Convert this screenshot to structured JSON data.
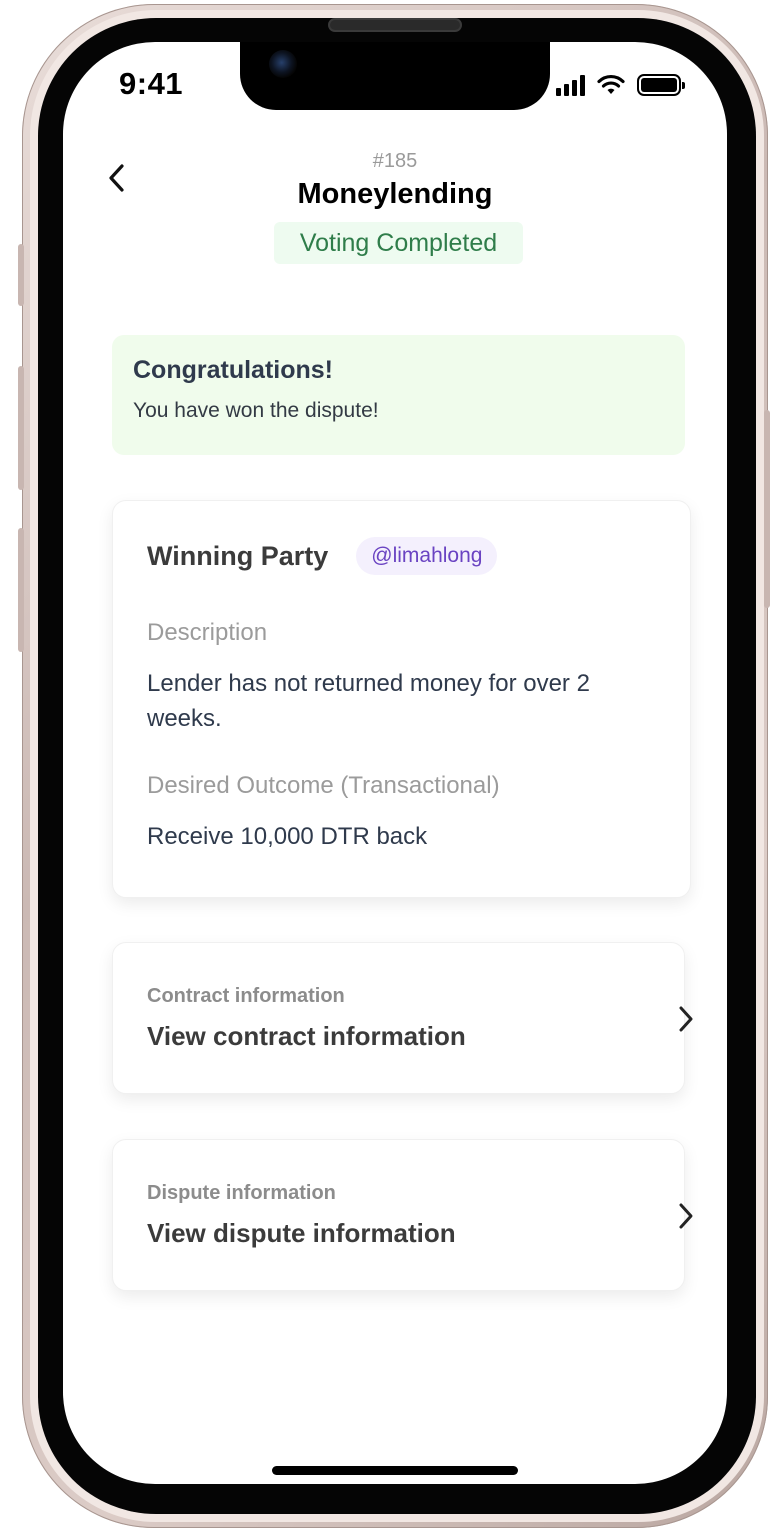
{
  "status_bar": {
    "time": "9:41"
  },
  "header": {
    "dispute_id": "#185",
    "title": "Moneylending",
    "status": "Voting Completed"
  },
  "banner": {
    "title": "Congratulations!",
    "message": "You have won the dispute!"
  },
  "winning_card": {
    "label": "Winning Party",
    "handle": "@limahlong",
    "description_label": "Description",
    "description": "Lender has not returned money for over 2 weeks.",
    "outcome_label": "Desired Outcome (Transactional)",
    "outcome": "Receive 10,000 DTR back"
  },
  "links": [
    {
      "label": "Contract information",
      "title": "View contract information"
    },
    {
      "label": "Dispute information",
      "title": "View dispute information"
    }
  ],
  "colors": {
    "status_green": "#2f7d4a",
    "banner_bg": "#f0fcec",
    "handle_purple": "#6a43c2",
    "frame": "#cbb9b4"
  },
  "icons": {
    "back": "chevron-left-icon",
    "link_arrow": "chevron-right-icon",
    "signal": "cellular-signal-icon",
    "wifi": "wifi-icon",
    "battery": "battery-icon"
  }
}
